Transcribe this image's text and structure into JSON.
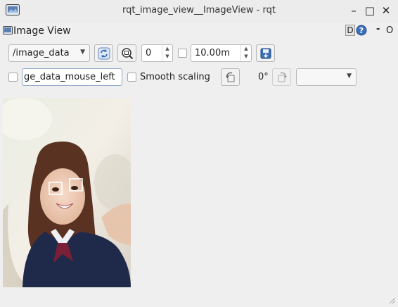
{
  "window": {
    "title": "rqt_image_view__ImageView - rqt",
    "minimize_glyph": "–",
    "maximize_glyph": "□",
    "close_glyph": "✕"
  },
  "dock": {
    "title": "Image View",
    "help_label": "D",
    "help_icon": "help-icon",
    "minus_label": "-",
    "close_label": "O"
  },
  "toolbar": {
    "topic": "/image_data",
    "zoom_value": "0",
    "max_range": "10.00m",
    "mouse_topic": "ge_data_mouse_left",
    "smooth_scaling_label": "Smooth scaling",
    "rotation_label": "0°",
    "color_scheme": ""
  },
  "icons": {
    "refresh": "refresh-icon",
    "fit": "zoom-fit-icon",
    "save": "save-icon",
    "rotate_left": "rotate-left-icon",
    "rotate_right": "rotate-right-icon"
  },
  "colors": {
    "accent": "#3c77c9",
    "face_box": "#ffffff",
    "window_bg": "#efefef"
  }
}
